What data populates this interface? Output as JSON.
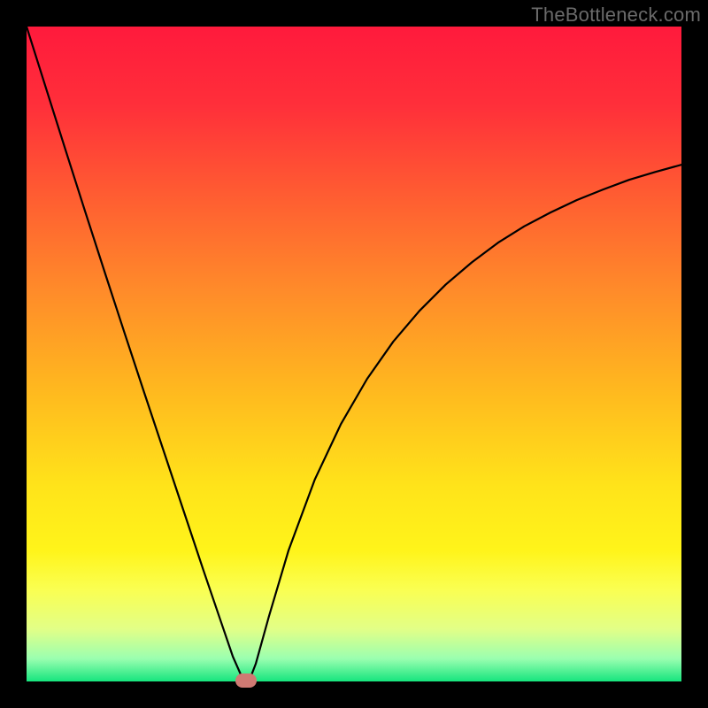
{
  "watermark": "TheBottleneck.com",
  "gradient": {
    "stops": [
      {
        "offset": 0.0,
        "color": "#ff1a3c"
      },
      {
        "offset": 0.12,
        "color": "#ff2f3a"
      },
      {
        "offset": 0.25,
        "color": "#ff5a32"
      },
      {
        "offset": 0.4,
        "color": "#ff8a2a"
      },
      {
        "offset": 0.55,
        "color": "#ffb71f"
      },
      {
        "offset": 0.7,
        "color": "#ffe31a"
      },
      {
        "offset": 0.8,
        "color": "#fff41a"
      },
      {
        "offset": 0.86,
        "color": "#faff52"
      },
      {
        "offset": 0.92,
        "color": "#e2ff87"
      },
      {
        "offset": 0.965,
        "color": "#9bffb0"
      },
      {
        "offset": 1.0,
        "color": "#16e57e"
      }
    ]
  },
  "chart_data": {
    "type": "line",
    "title": "",
    "xlabel": "",
    "ylabel": "",
    "xlim": [
      0,
      100
    ],
    "ylim": [
      0,
      100
    ],
    "grid": false,
    "series": [
      {
        "name": "curve",
        "x": [
          0,
          3,
          6,
          9,
          12,
          15,
          18,
          21,
          24,
          27,
          30,
          31.5,
          33,
          34,
          35,
          37,
          40,
          44,
          48,
          52,
          56,
          60,
          64,
          68,
          72,
          76,
          80,
          84,
          88,
          92,
          96,
          100
        ],
        "values": [
          100,
          90.5,
          81,
          71.6,
          62.3,
          53.1,
          44,
          35,
          26,
          17,
          8.2,
          3.8,
          0.4,
          0.1,
          2.7,
          9.9,
          20,
          30.8,
          39.3,
          46.2,
          51.9,
          56.6,
          60.6,
          64,
          67,
          69.5,
          71.6,
          73.5,
          75.1,
          76.6,
          77.8,
          78.9
        ]
      }
    ],
    "marker": {
      "x": 33.5,
      "y": 0.1,
      "color": "#cf7a73"
    }
  }
}
